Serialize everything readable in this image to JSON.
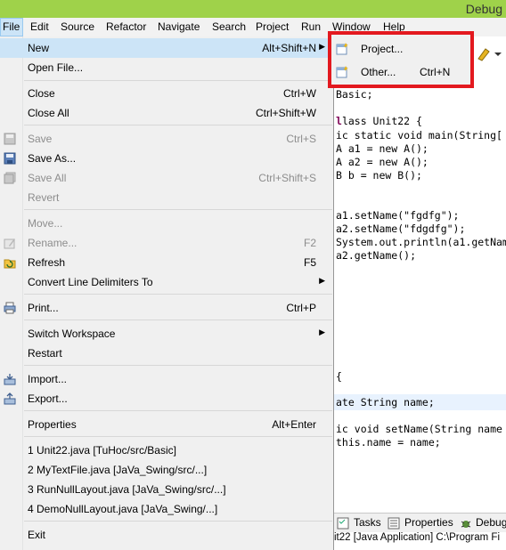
{
  "window": {
    "title": "Debug"
  },
  "menubar": [
    "File",
    "Edit",
    "Source",
    "Refactor",
    "Navigate",
    "Search",
    "Project",
    "Run",
    "Window",
    "Help"
  ],
  "file_menu": {
    "new": {
      "label": "New",
      "shortcut": "Alt+Shift+N"
    },
    "open_file": {
      "label": "Open File..."
    },
    "close": {
      "label": "Close",
      "shortcut": "Ctrl+W"
    },
    "close_all": {
      "label": "Close All",
      "shortcut": "Ctrl+Shift+W"
    },
    "save": {
      "label": "Save",
      "shortcut": "Ctrl+S"
    },
    "save_as": {
      "label": "Save As..."
    },
    "save_all": {
      "label": "Save All",
      "shortcut": "Ctrl+Shift+S"
    },
    "revert": {
      "label": "Revert"
    },
    "move": {
      "label": "Move..."
    },
    "rename": {
      "label": "Rename...",
      "shortcut": "F2"
    },
    "refresh": {
      "label": "Refresh",
      "shortcut": "F5"
    },
    "convert": {
      "label": "Convert Line Delimiters To"
    },
    "print": {
      "label": "Print...",
      "shortcut": "Ctrl+P"
    },
    "switch_workspace": {
      "label": "Switch Workspace"
    },
    "restart": {
      "label": "Restart"
    },
    "import": {
      "label": "Import..."
    },
    "export": {
      "label": "Export..."
    },
    "properties": {
      "label": "Properties",
      "shortcut": "Alt+Enter"
    },
    "recent": [
      "1 Unit22.java  [TuHoc/src/Basic]",
      "2 MyTextFile.java  [JaVa_Swing/src/...]",
      "3 RunNullLayout.java  [JaVa_Swing/src/...]",
      "4 DemoNullLayout.java  [JaVa_Swing/...]"
    ],
    "exit": {
      "label": "Exit"
    }
  },
  "new_submenu": {
    "project": {
      "label": "Project..."
    },
    "other": {
      "label": "Other...",
      "shortcut": "Ctrl+N"
    }
  },
  "editor": {
    "lines": [
      "Basic;",
      "lass Unit22 {",
      "ic static void main(String[",
      "A a1 = new A();",
      "A a2 = new A();",
      "B b = new B();",
      "a1.setName(\"fgdfg\");",
      "a2.setName(\"fdgdfg\");",
      "System.out.println(a1.getNam",
      "a2.getName();",
      "{",
      "ate String name;",
      "ic void setName(String name",
      "this.name = name;"
    ]
  },
  "bottom_panel": {
    "tabs": [
      "Tasks",
      "Properties",
      "Debug"
    ],
    "console": "it22 [Java Application] C:\\Program Fi"
  },
  "colors": {
    "accent": "#9fd24a",
    "highlight": "#cce4f7",
    "callout": "#e3191f"
  }
}
